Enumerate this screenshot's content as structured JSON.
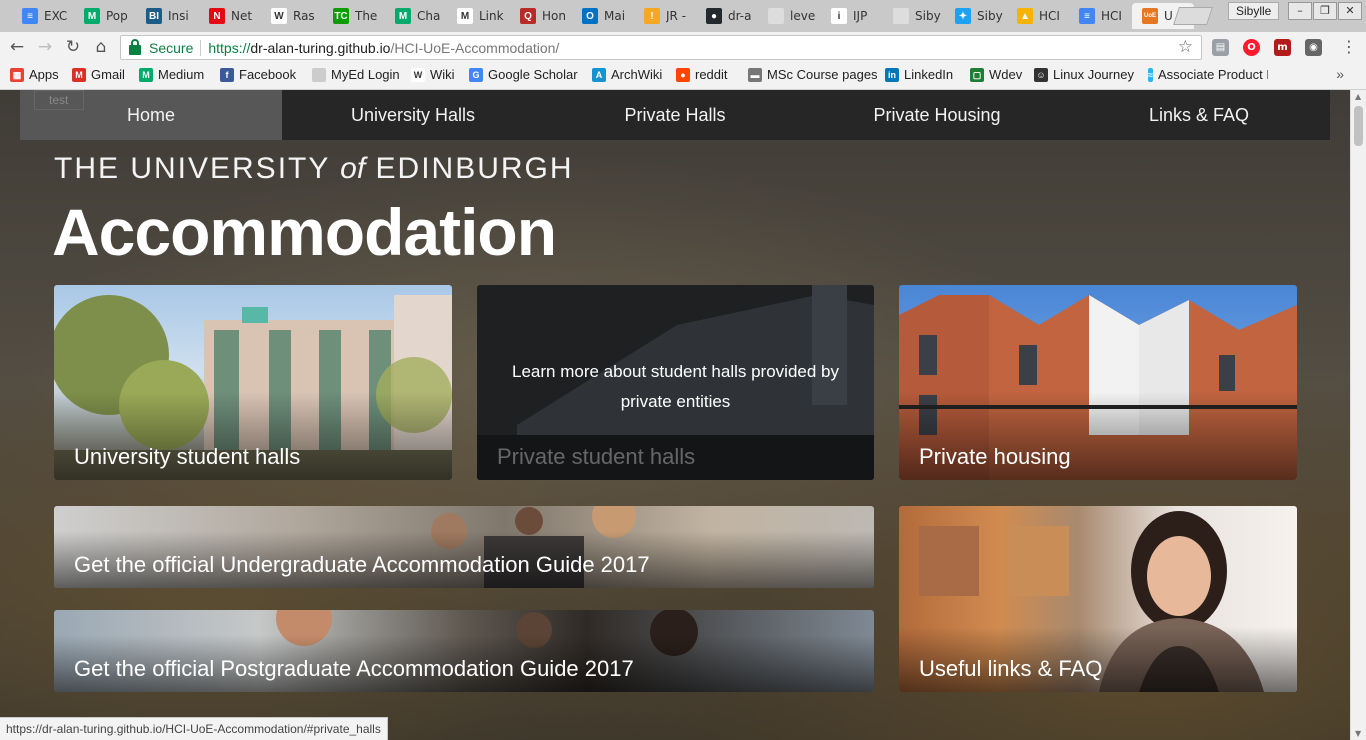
{
  "browser": {
    "tabs": [
      {
        "title": "EXC",
        "favicon": "docs-icon",
        "color": "#4285f4",
        "glyph": "≡"
      },
      {
        "title": "Pop",
        "favicon": "medium-icon",
        "color": "#00ab6c",
        "glyph": "M"
      },
      {
        "title": "Insi",
        "favicon": "business-insider-icon",
        "color": "#1a5c8a",
        "glyph": "BI"
      },
      {
        "title": "Net",
        "favicon": "netflix-icon",
        "color": "#e50914",
        "glyph": "N"
      },
      {
        "title": "Ras",
        "favicon": "wikipedia-icon",
        "color": "#ffffff",
        "glyph": "W"
      },
      {
        "title": "The",
        "favicon": "techcrunch-icon",
        "color": "#0a9e01",
        "glyph": "TC"
      },
      {
        "title": "Cha",
        "favicon": "medium-icon",
        "color": "#00ab6c",
        "glyph": "M"
      },
      {
        "title": "Link",
        "favicon": "gmail-icon",
        "color": "#ffffff",
        "glyph": "M"
      },
      {
        "title": "Hon",
        "favicon": "quora-icon",
        "color": "#b92b27",
        "glyph": "Q"
      },
      {
        "title": "Mai",
        "favicon": "outlook-icon",
        "color": "#0072c6",
        "glyph": "O"
      },
      {
        "title": "JR -",
        "favicon": "jr-icon",
        "color": "#f5a623",
        "glyph": "!"
      },
      {
        "title": "dr-a",
        "favicon": "github-icon",
        "color": "#24292e",
        "glyph": "●"
      },
      {
        "title": "leve",
        "favicon": "document-icon",
        "color": "#dddddd",
        "glyph": ""
      },
      {
        "title": "IJP",
        "favicon": "ijp-icon",
        "color": "#ffffff",
        "glyph": "i"
      },
      {
        "title": "Siby",
        "favicon": "document-icon",
        "color": "#dddddd",
        "glyph": ""
      },
      {
        "title": "Siby",
        "favicon": "twitter-icon",
        "color": "#1da1f2",
        "glyph": "✦"
      },
      {
        "title": "HCI",
        "favicon": "drive-icon",
        "color": "#f4b400",
        "glyph": "▲"
      },
      {
        "title": "HCI",
        "favicon": "docs-icon",
        "color": "#4285f4",
        "glyph": "≡"
      },
      {
        "title": "U",
        "favicon": "uoe-icon",
        "color": "#e87722",
        "glyph": "UoE"
      }
    ],
    "active_tab_index": 18,
    "profile_name": "Sibylle",
    "window_controls": [
      "–",
      "❐",
      "✕"
    ],
    "secure_label": "Secure",
    "url_protocol": "https://",
    "url_host": "dr-alan-turing.github.io",
    "url_path": "/HCI-UoE-Accommodation/",
    "bookmarks": [
      {
        "label": "Apps",
        "icon": "apps-grid-icon",
        "color": "#e94235"
      },
      {
        "label": "Gmail",
        "icon": "gmail-icon",
        "color": "#d93025"
      },
      {
        "label": "Medium",
        "icon": "medium-icon",
        "color": "#00ab6c"
      },
      {
        "label": "Facebook",
        "icon": "facebook-icon",
        "color": "#3b5998"
      },
      {
        "label": "MyEd Login",
        "icon": "document-icon",
        "color": "#cccccc"
      },
      {
        "label": "Wiki",
        "icon": "wikipedia-icon",
        "color": "#ffffff"
      },
      {
        "label": "Google Scholar",
        "icon": "scholar-icon",
        "color": "#4285f4"
      },
      {
        "label": "ArchWiki",
        "icon": "arch-icon",
        "color": "#1793d1"
      },
      {
        "label": "reddit",
        "icon": "reddit-icon",
        "color": "#ff4500"
      },
      {
        "label": "MSc Course pages",
        "icon": "folder-icon",
        "color": "#777777"
      },
      {
        "label": "LinkedIn",
        "icon": "linkedin-icon",
        "color": "#0077b5"
      },
      {
        "label": "Wdev",
        "icon": "wdev-icon",
        "color": "#1e7e34"
      },
      {
        "label": "Linux Journey",
        "icon": "linux-journey-icon",
        "color": "#333333"
      },
      {
        "label": "Associate Product M",
        "icon": "product-icon",
        "color": "#29b6f6"
      }
    ],
    "status_url": "https://dr-alan-turing.github.io/HCI-UoE-Accommodation/#private_halls"
  },
  "site": {
    "broken_image_alt": "test",
    "nav": [
      {
        "label": "Home",
        "active": true
      },
      {
        "label": "University Halls",
        "active": false
      },
      {
        "label": "Private Halls",
        "active": false
      },
      {
        "label": "Private Housing",
        "active": false
      },
      {
        "label": "Links & FAQ",
        "active": false
      }
    ],
    "university_name_pre": "THE UNIVERSITY ",
    "university_name_of": "of",
    "university_name_post": " EDINBURGH",
    "heading": "Accommodation",
    "cards": {
      "university_halls": "University student halls",
      "private_halls": "Private student halls",
      "private_halls_hover": "Learn more about student halls provided by private entities",
      "private_housing": "Private housing",
      "ug_guide": "Get the official Undergraduate Accommodation Guide 2017",
      "pg_guide": "Get the official Postgraduate Accommodation Guide 2017",
      "faq": "Useful links & FAQ"
    }
  }
}
